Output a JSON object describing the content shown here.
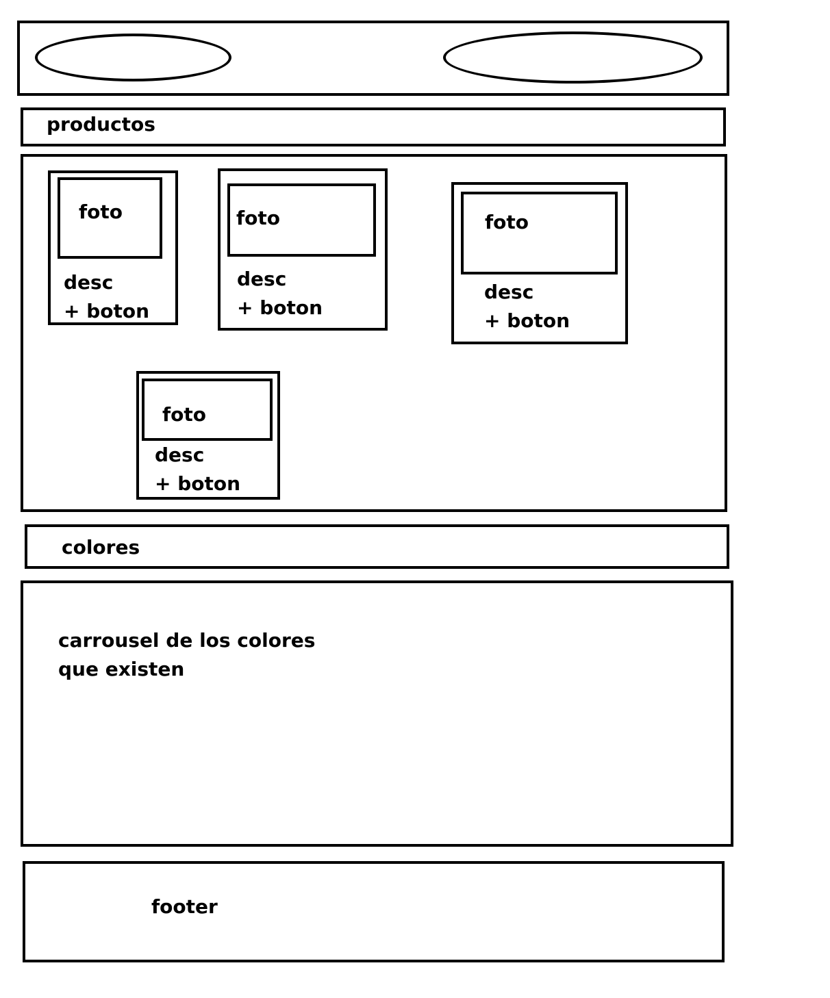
{
  "header": {
    "left_oval_icon": "oval-placeholder",
    "right_oval_icon": "oval-placeholder"
  },
  "productos_bar": {
    "label": "productos"
  },
  "product_cards": [
    {
      "photo_label": "foto",
      "desc_label": "desc",
      "button_label": "+ boton"
    },
    {
      "photo_label": "foto",
      "desc_label": "desc",
      "button_label": "+ boton"
    },
    {
      "photo_label": "foto",
      "desc_label": "desc",
      "button_label": "+ boton"
    },
    {
      "photo_label": "foto",
      "desc_label": "desc",
      "button_label": "+ boton"
    }
  ],
  "colores_bar": {
    "label": "colores"
  },
  "carousel": {
    "line1": "carrousel de los colores",
    "line2": "que existen"
  },
  "footer": {
    "label": "footer"
  },
  "colors": {
    "stroke": "#000000",
    "background": "#ffffff"
  }
}
